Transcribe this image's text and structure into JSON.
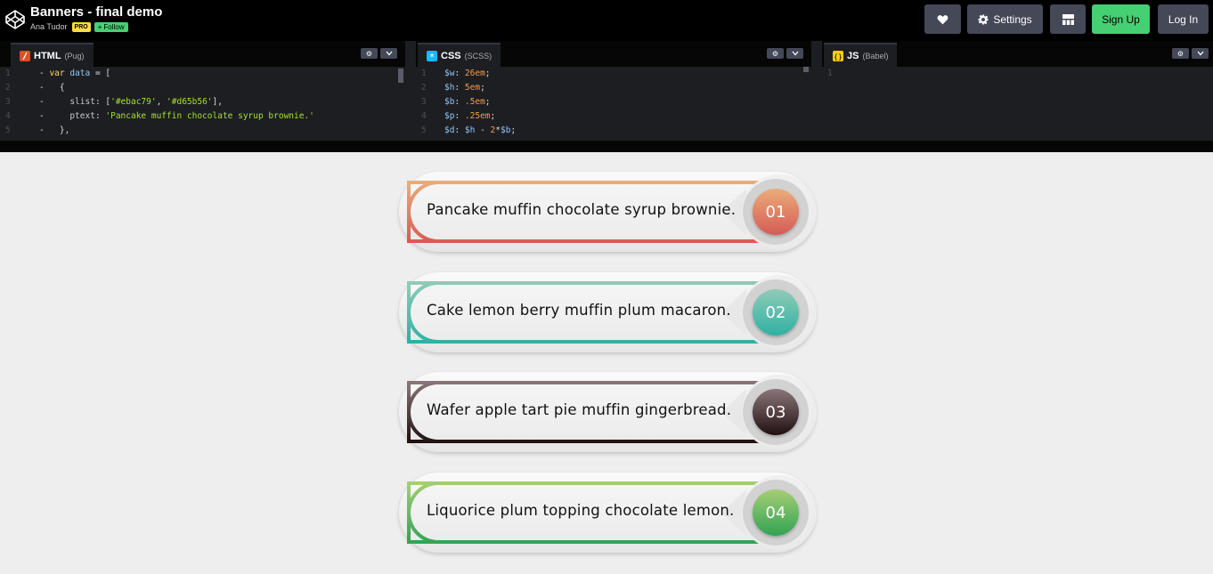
{
  "header": {
    "title": "Banners - final demo",
    "author": "Ana Tudor",
    "pro_badge": "PRO",
    "follow_label": "Follow",
    "follow_prefix": "+",
    "buttons": {
      "heart_icon": "heart-icon",
      "settings_label": "Settings",
      "settings_icon": "gear-icon",
      "layout_icon": "layout-grid-icon",
      "signup_label": "Sign Up",
      "login_label": "Log In"
    },
    "colors": {
      "signup": "#47cf73",
      "pro": "#ffdd40",
      "button": "#444857"
    }
  },
  "editors": {
    "html": {
      "name": "HTML",
      "preprocessor": "(Pug)",
      "icon_color": "#e44d26",
      "lines": [
        {
          "num": "1",
          "code": "- var data = ["
        },
        {
          "num": "2",
          "code": "-   {"
        },
        {
          "num": "3",
          "code": "-     slist: ['#ebac79', '#d65b56'],"
        },
        {
          "num": "4",
          "code": "-     ptext: 'Pancake muffin chocolate syrup brownie.'"
        },
        {
          "num": "5",
          "code": "-   },"
        }
      ]
    },
    "css": {
      "name": "CSS",
      "preprocessor": "(SCSS)",
      "icon_color": "#0ebeff",
      "lines": [
        {
          "num": "1",
          "code": "$w: 26em;"
        },
        {
          "num": "2",
          "code": "$h: 5em;"
        },
        {
          "num": "3",
          "code": "$b: .5em;"
        },
        {
          "num": "4",
          "code": "$p: .25em;"
        },
        {
          "num": "5",
          "code": "$d: $h - 2*$b;"
        }
      ]
    },
    "js": {
      "name": "JS",
      "preprocessor": "(Babel)",
      "icon_color": "#fcd000",
      "lines": [
        {
          "num": "1",
          "code": ""
        }
      ]
    }
  },
  "banners": [
    {
      "text": "Pancake muffin chocolate syrup brownie.",
      "number": "01",
      "colors": [
        "#ebac79",
        "#d65b56"
      ]
    },
    {
      "text": "Cake lemon berry muffin plum macaron.",
      "number": "02",
      "colors": [
        "#90cbb7",
        "#2fb1a3"
      ]
    },
    {
      "text": "Wafer apple tart pie muffin gingerbread.",
      "number": "03",
      "colors": [
        "#8a767a",
        "#201011"
      ]
    },
    {
      "text": "Liquorice plum topping chocolate lemon.",
      "number": "04",
      "colors": [
        "#a6ce75",
        "#31a354"
      ]
    }
  ]
}
